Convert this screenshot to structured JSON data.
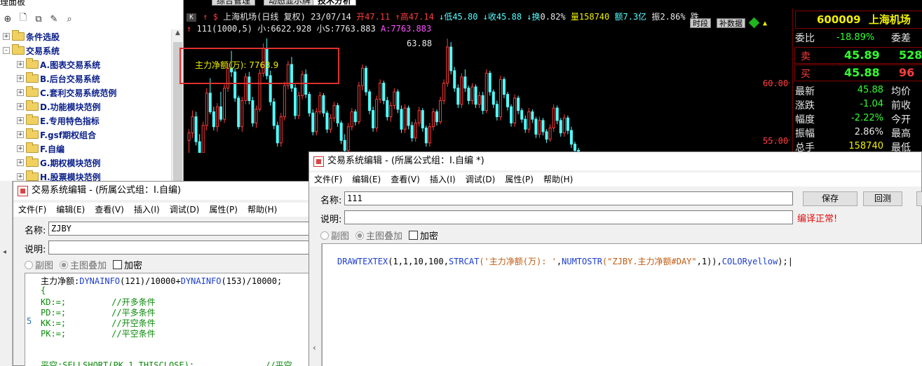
{
  "tree": {
    "title": "理面板",
    "toolbar_icons": [
      "add-icon",
      "new-file-icon",
      "copy-icon",
      "edit-icon",
      "search-icon"
    ],
    "items": [
      {
        "expander": "+",
        "label": "条件选股",
        "level": 0
      },
      {
        "expander": "-",
        "label": "交易系统",
        "level": 0
      },
      {
        "expander": "+",
        "label": "A.图表交易系统",
        "level": 1
      },
      {
        "expander": "+",
        "label": "B.后台交易系统",
        "level": 1
      },
      {
        "expander": "+",
        "label": "C.套利交易系统范例",
        "level": 1
      },
      {
        "expander": "+",
        "label": "D.功能模块范例",
        "level": 1
      },
      {
        "expander": "+",
        "label": "E.专用特色指标",
        "level": 1
      },
      {
        "expander": "+",
        "label": "F.gsf期权组合",
        "level": 1
      },
      {
        "expander": "+",
        "label": "F.自编",
        "level": 1
      },
      {
        "expander": "+",
        "label": "G.期权模块范例",
        "level": 1
      },
      {
        "expander": "+",
        "label": "H.股票模块范例",
        "level": 1
      }
    ]
  },
  "tabs": [
    "综合管理",
    "动态显示牌",
    "技术分析"
  ],
  "chart": {
    "k_label": "K",
    "stock_line": {
      "arrow": "↑",
      "dollar": "$",
      "name": "上海机场(日线 复权)",
      "date": "23/07/14",
      "open_label": "开",
      "open": "47.11",
      "high_label": "↑高",
      "high": "47.14",
      "low_label": "↓低",
      "low": "45.80",
      "close_label": "↓收",
      "close": "45.88",
      "turnover_label": "↓换",
      "turnover": "0.82%",
      "vol_label": "量",
      "vol": "158740",
      "amount_label": "额",
      "amount": "7.3亿",
      "amp_label": "振",
      "amp": "2.86%",
      "rest": "跌"
    },
    "indicator_line": {
      "marker": "↑",
      "name": "111(1000,5)",
      "small_label": "小:",
      "small": "6622.928",
      "s_label": "小S:",
      "s": "7763.883",
      "a_label": "A:",
      "a": "7763.883"
    },
    "buttons": {
      "period": "时段",
      "data": "补数据"
    },
    "price_labels": {
      "peak": "63.88",
      "level1": "60.00",
      "level2": "55.00"
    },
    "annotation": "主力净额(万): 7763.9"
  },
  "chart_data": {
    "type": "candlestick",
    "title": "上海机场(日线 复权)",
    "ylim": [
      53.8,
      64.5
    ],
    "y_ticks": [
      60.0,
      55.0
    ],
    "peak_label": 63.88,
    "candles": [
      [
        55.7,
        56.6,
        54.6,
        56.3
      ],
      [
        56.3,
        58.1,
        55.9,
        57.6
      ],
      [
        57.6,
        58.0,
        55.3,
        55.6
      ],
      [
        55.6,
        56.2,
        53.9,
        54.1
      ],
      [
        54.1,
        57.2,
        53.9,
        56.9
      ],
      [
        56.9,
        59.9,
        56.5,
        59.5
      ],
      [
        59.5,
        60.7,
        57.8,
        58.0
      ],
      [
        58.0,
        58.4,
        56.5,
        56.8
      ],
      [
        56.8,
        58.7,
        56.4,
        58.4
      ],
      [
        58.4,
        59.6,
        57.2,
        57.4
      ],
      [
        57.4,
        60.2,
        57.1,
        59.9
      ],
      [
        59.9,
        61.9,
        59.6,
        61.5
      ],
      [
        61.5,
        62.9,
        60.8,
        61.2
      ],
      [
        61.2,
        61.5,
        58.8,
        59.1
      ],
      [
        59.1,
        59.3,
        56.6,
        56.8
      ],
      [
        56.8,
        59.2,
        56.4,
        58.9
      ],
      [
        58.9,
        61.1,
        58.6,
        60.8
      ],
      [
        60.8,
        61.2,
        58.6,
        58.9
      ],
      [
        58.9,
        59.2,
        56.8,
        57.1
      ],
      [
        57.1,
        58.5,
        56.7,
        58.2
      ],
      [
        58.2,
        61.4,
        58.0,
        61.1
      ],
      [
        61.1,
        63.5,
        60.8,
        63.1
      ],
      [
        63.1,
        63.9,
        60.6,
        60.9
      ],
      [
        60.9,
        61.3,
        58.5,
        58.8
      ],
      [
        58.8,
        59.1,
        56.6,
        56.9
      ],
      [
        56.9,
        57.2,
        55.2,
        55.5
      ],
      [
        55.5,
        57.9,
        55.2,
        57.6
      ],
      [
        57.6,
        60.4,
        57.3,
        60.1
      ],
      [
        60.1,
        62.1,
        59.8,
        61.8
      ],
      [
        61.8,
        62.4,
        59.6,
        59.9
      ],
      [
        59.9,
        60.2,
        57.4,
        57.7
      ],
      [
        57.7,
        59.6,
        57.4,
        59.3
      ],
      [
        59.3,
        61.3,
        59.0,
        61.0
      ],
      [
        61.0,
        61.4,
        59.1,
        59.4
      ],
      [
        59.4,
        59.6,
        57.6,
        57.9
      ],
      [
        57.9,
        58.2,
        56.1,
        56.4
      ],
      [
        56.4,
        58.3,
        56.1,
        58.0
      ],
      [
        58.0,
        59.6,
        57.8,
        59.3
      ],
      [
        59.3,
        59.5,
        57.6,
        57.9
      ],
      [
        57.9,
        58.1,
        56.3,
        56.6
      ],
      [
        56.6,
        57.8,
        56.3,
        57.5
      ],
      [
        57.5,
        58.8,
        57.2,
        58.5
      ],
      [
        58.5,
        58.7,
        56.8,
        57.1
      ],
      [
        57.1,
        57.3,
        55.4,
        55.7
      ],
      [
        55.7,
        56.2,
        54.6,
        54.9
      ],
      [
        54.9,
        57.1,
        54.6,
        56.8
      ],
      [
        56.8,
        58.3,
        56.5,
        58.0
      ],
      [
        58.0,
        58.2,
        56.9,
        57.2
      ],
      [
        57.2,
        60.4,
        57.0,
        60.1
      ],
      [
        60.1,
        61.8,
        59.7,
        61.5
      ],
      [
        61.5,
        61.7,
        59.3,
        59.6
      ],
      [
        59.6,
        59.8,
        57.8,
        58.1
      ],
      [
        58.1,
        58.4,
        56.4,
        56.7
      ],
      [
        56.7,
        59.3,
        56.4,
        59.0
      ],
      [
        59.0,
        60.6,
        58.7,
        60.3
      ],
      [
        60.3,
        60.5,
        58.6,
        58.9
      ],
      [
        58.9,
        59.2,
        57.3,
        57.6
      ],
      [
        57.6,
        58.8,
        57.2,
        58.5
      ],
      [
        58.5,
        59.9,
        58.2,
        59.6
      ],
      [
        59.6,
        59.8,
        57.9,
        58.2
      ],
      [
        58.2,
        58.5,
        56.3,
        56.6
      ],
      [
        56.6,
        58.6,
        56.3,
        58.3
      ],
      [
        58.3,
        58.5,
        56.6,
        56.9
      ],
      [
        56.9,
        57.2,
        55.6,
        55.9
      ],
      [
        55.9,
        57.4,
        55.6,
        57.1
      ],
      [
        57.1,
        58.4,
        56.8,
        58.1
      ],
      [
        58.1,
        58.3,
        56.4,
        56.7
      ],
      [
        56.7,
        56.9,
        55.2,
        55.5
      ],
      [
        55.5,
        57.1,
        55.2,
        56.8
      ],
      [
        56.8,
        58.3,
        56.5,
        58.0
      ],
      [
        58.0,
        58.2,
        56.9,
        57.2
      ],
      [
        57.2,
        59.2,
        57.0,
        58.9
      ],
      [
        58.9,
        60.6,
        58.6,
        60.3
      ],
      [
        60.3,
        63.88,
        60.0,
        63.2
      ],
      [
        63.2,
        63.6,
        61.0,
        61.3
      ],
      [
        61.3,
        61.6,
        59.6,
        59.9
      ],
      [
        59.9,
        60.2,
        58.3,
        58.6
      ],
      [
        58.6,
        61.1,
        58.3,
        60.8
      ],
      [
        60.8,
        61.4,
        59.6,
        59.9
      ],
      [
        59.9,
        60.1,
        58.6,
        58.9
      ],
      [
        58.9,
        60.3,
        58.6,
        60.0
      ],
      [
        60.0,
        60.2,
        58.3,
        58.6
      ],
      [
        58.6,
        59.6,
        58.3,
        59.3
      ],
      [
        59.3,
        59.6,
        57.8,
        58.1
      ],
      [
        58.1,
        61.4,
        57.9,
        61.1
      ],
      [
        61.1,
        61.3,
        59.3,
        59.6
      ],
      [
        59.6,
        59.8,
        58.3,
        58.6
      ],
      [
        58.6,
        58.9,
        57.3,
        57.6
      ],
      [
        57.6,
        60.9,
        57.3,
        60.6
      ],
      [
        60.6,
        60.8,
        59.1,
        59.4
      ],
      [
        59.4,
        59.6,
        58.1,
        58.4
      ],
      [
        58.4,
        58.6,
        56.8,
        57.1
      ],
      [
        57.1,
        59.4,
        56.8,
        59.1
      ],
      [
        59.1,
        59.3,
        57.8,
        58.1
      ],
      [
        58.1,
        58.3,
        57.1,
        57.4
      ],
      [
        57.4,
        57.7,
        56.3,
        56.6
      ],
      [
        56.6,
        58.3,
        56.3,
        58.0
      ],
      [
        58.0,
        58.2,
        57.1,
        57.4
      ],
      [
        57.4,
        57.6,
        55.9,
        56.2
      ],
      [
        56.2,
        57.6,
        55.9,
        57.3
      ],
      [
        57.3,
        57.5,
        56.1,
        56.4
      ],
      [
        56.4,
        56.6,
        55.5,
        55.8
      ],
      [
        55.8,
        57.0,
        55.6,
        56.7
      ],
      [
        56.7,
        58.6,
        56.4,
        58.3
      ],
      [
        58.3,
        58.5,
        57.0,
        57.3
      ],
      [
        57.3,
        57.5,
        56.0,
        56.3
      ],
      [
        56.3,
        57.8,
        56.0,
        57.5
      ],
      [
        57.5,
        57.7,
        56.2,
        56.5
      ],
      [
        56.5,
        56.8,
        55.1,
        55.4
      ],
      [
        55.4,
        55.6,
        54.6,
        54.9
      ],
      [
        54.9,
        55.1,
        54.2,
        54.5
      ]
    ]
  },
  "quote": {
    "code": "600009",
    "name": "上海机场",
    "weibi_label": "委比",
    "weibi": "-18.89%",
    "weicha_label": "委差",
    "sell_label": "卖",
    "sell_price": "45.89",
    "sell_vol": "528",
    "buy_label": "买",
    "buy_price": "45.88",
    "buy_vol": "96",
    "rows": [
      {
        "label": "最新",
        "value": "45.88",
        "label2": "均价",
        "color": "#32ff32"
      },
      {
        "label": "涨跌",
        "value": "-1.04",
        "label2": "前收",
        "color": "#32ff32"
      },
      {
        "label": "幅度",
        "value": "-2.22%",
        "label2": "今开",
        "color": "#32ff32"
      },
      {
        "label": "振幅",
        "value": "2.86%",
        "label2": "最高",
        "color": "#e8e8e8"
      },
      {
        "label": "总手",
        "value": "158740",
        "label2": "最低",
        "color": "#f0f000"
      }
    ]
  },
  "dialog_left": {
    "title": "交易系统编辑 - (所属公式组：I.自编)",
    "menu": [
      "文件(F)",
      "编辑(E)",
      "查看(V)",
      "插入(I)",
      "调试(D)",
      "属性(P)",
      "帮助(H)"
    ],
    "name_label": "名称:",
    "name_value": "ZJBY",
    "desc_label": "说明:",
    "desc_value": "",
    "radio_sub": "副图",
    "radio_main": "主图叠加",
    "encrypt": "加密",
    "line_number": "5",
    "code": [
      {
        "parts": [
          {
            "t": "主力净额:",
            "c": "k-black"
          },
          {
            "t": "DYNAINFO",
            "c": "k-blue"
          },
          {
            "t": "(121)/10000+",
            "c": "k-black"
          },
          {
            "t": "DYNAINFO",
            "c": "k-blue"
          },
          {
            "t": "(153)/10000;",
            "c": "k-black"
          }
        ]
      },
      {
        "parts": [
          {
            "t": "{",
            "c": "k-green"
          }
        ]
      },
      {
        "parts": [
          {
            "t": "KD:=;         //开多条件",
            "c": "k-green"
          }
        ]
      },
      {
        "parts": [
          {
            "t": "PD:=;         //平多条件",
            "c": "k-green"
          }
        ]
      },
      {
        "parts": [
          {
            "t": "KK:=;         //开空条件",
            "c": "k-green"
          }
        ]
      },
      {
        "parts": [
          {
            "t": "PK:=;         //平空条件",
            "c": "k-green"
          }
        ]
      },
      {
        "parts": [
          {
            "t": "",
            "c": "k-green"
          }
        ]
      },
      {
        "parts": [
          {
            "t": "",
            "c": "k-green"
          }
        ]
      },
      {
        "parts": [
          {
            "t": "平空:SELLSHORT(PK,1,THISCLOSE);              //平空",
            "c": "k-green"
          }
        ]
      }
    ]
  },
  "dialog_right": {
    "title": "交易系统编辑 - (所属公式组：I.自编 *)",
    "menu": [
      "文件(F)",
      "编辑(E)",
      "查看(V)",
      "插入(I)",
      "调试(D)",
      "属性(P)",
      "帮助(H)"
    ],
    "name_label": "名称:",
    "name_value": "111",
    "desc_label": "说明:",
    "desc_value": "",
    "save_button": "保存",
    "test_button": "回测",
    "status": "编译正常!",
    "radio_sub": "副图",
    "radio_main": "主图叠加",
    "encrypt": "加密",
    "code_parts": [
      {
        "t": "DRAWTEXTEX",
        "c": "k-blue"
      },
      {
        "t": "(1,1,10,100,",
        "c": "k-black"
      },
      {
        "t": "STRCAT",
        "c": "k-blue"
      },
      {
        "t": "('主力净额(万): '",
        "c": "k-orange"
      },
      {
        "t": ",",
        "c": "k-black"
      },
      {
        "t": "NUMTOSTR",
        "c": "k-blue"
      },
      {
        "t": "(\"ZJBY.主力净额#DAY\"",
        "c": "k-orange"
      },
      {
        "t": ",1)),",
        "c": "k-black"
      },
      {
        "t": "COLORyellow",
        "c": "k-blue"
      },
      {
        "t": ");",
        "c": "k-black"
      }
    ],
    "scroll_arrow": "‹"
  },
  "colors": {
    "up": "#ff3c3c",
    "down": "#54ffff",
    "chart_bg": "#000000",
    "dialog_bg": "#f0f0f0"
  }
}
